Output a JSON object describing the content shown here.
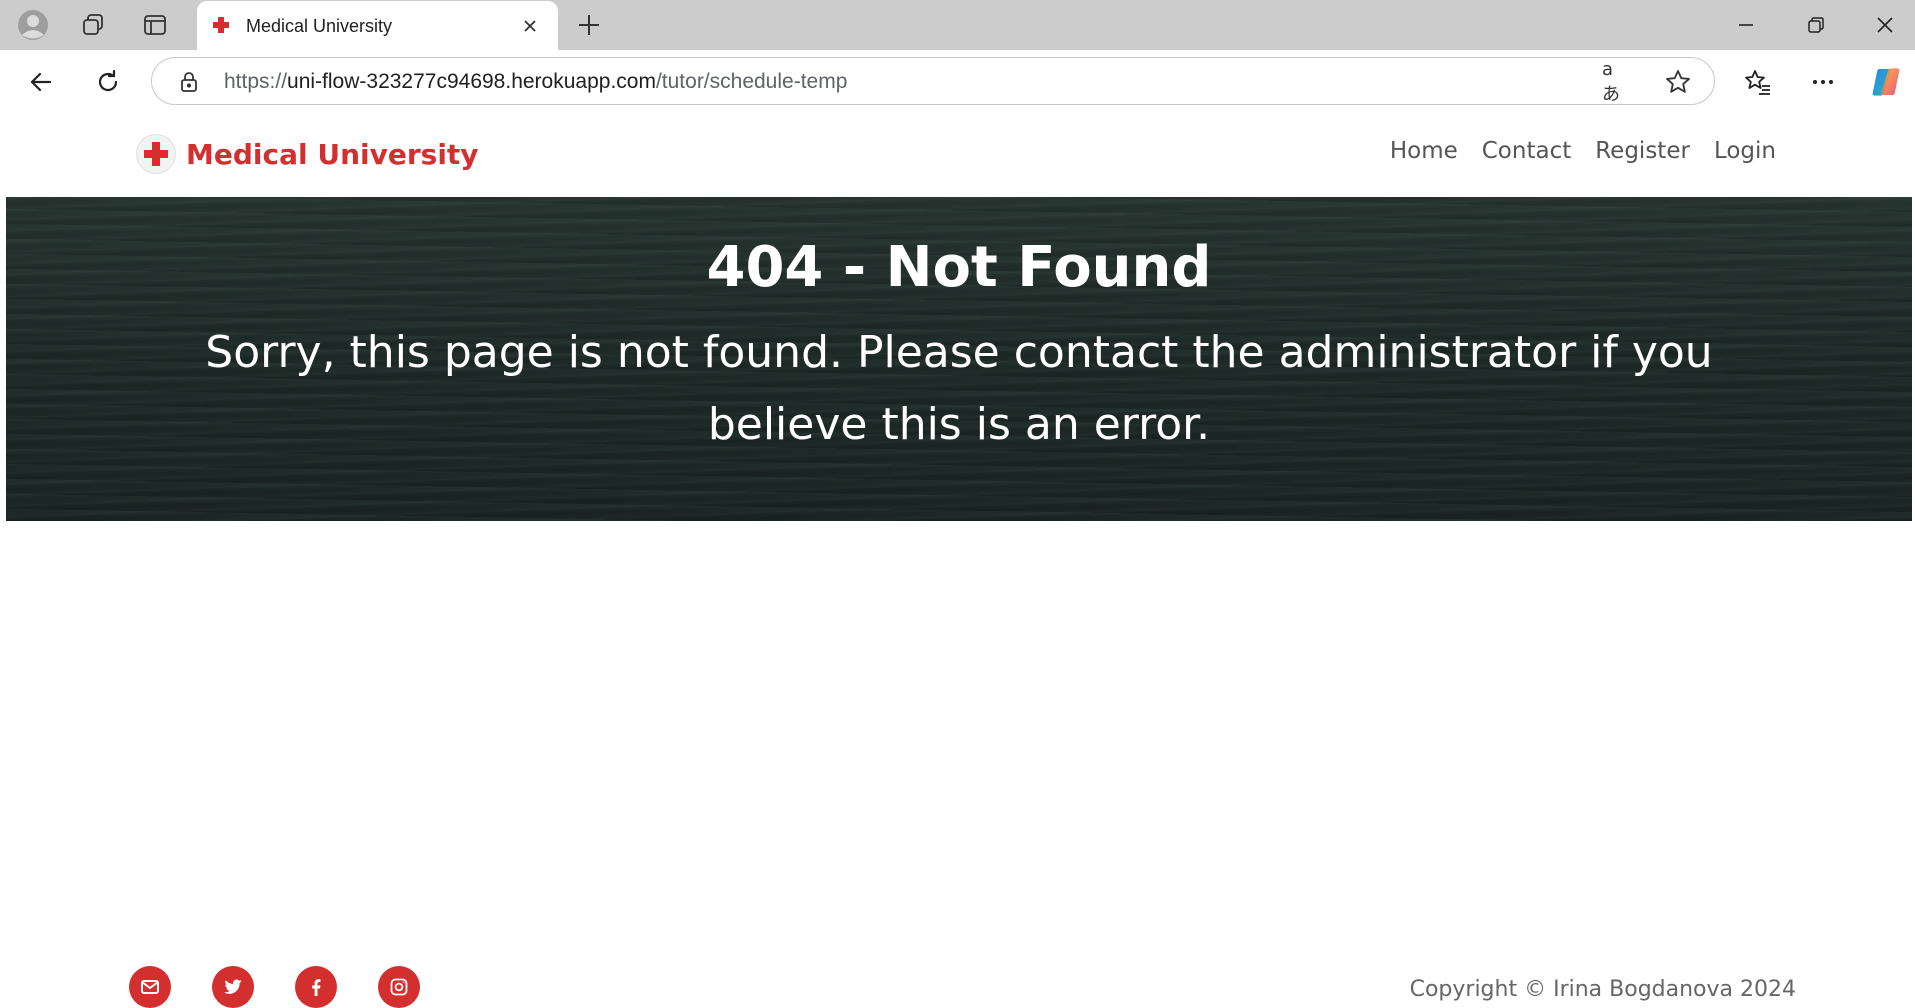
{
  "browser": {
    "tab": {
      "title": "Medical University",
      "favicon": "red-cross-icon"
    },
    "address_bar": {
      "scheme": "https://",
      "host": "uni-flow-323277c94698.herokuapp.com",
      "path": "/tutor/schedule-temp"
    },
    "read_aloud_glyph": "aあ",
    "icons": [
      "profile-icon",
      "workspaces-icon",
      "tab-actions-icon",
      "new-tab-icon",
      "minimize-icon",
      "restore-icon",
      "close-window-icon",
      "back-icon",
      "refresh-icon",
      "lock-icon",
      "favorite-star-icon",
      "favorites-icon",
      "more-icon",
      "copilot-icon"
    ]
  },
  "navbar": {
    "brand": "Medical University",
    "links": [
      "Home",
      "Contact",
      "Register",
      "Login"
    ]
  },
  "hero": {
    "title": "404 - Not Found",
    "message": "Sorry, this page is not found. Please contact the administrator if you believe this is an error."
  },
  "footer": {
    "social": [
      "email-icon",
      "twitter-icon",
      "facebook-icon",
      "instagram-icon"
    ],
    "copyright": "Copyright © Irina Bogdanova 2024"
  },
  "colors": {
    "brand_red": "#d32f2f",
    "hero_bg": "#1f2b28",
    "nav_text": "#555555"
  }
}
